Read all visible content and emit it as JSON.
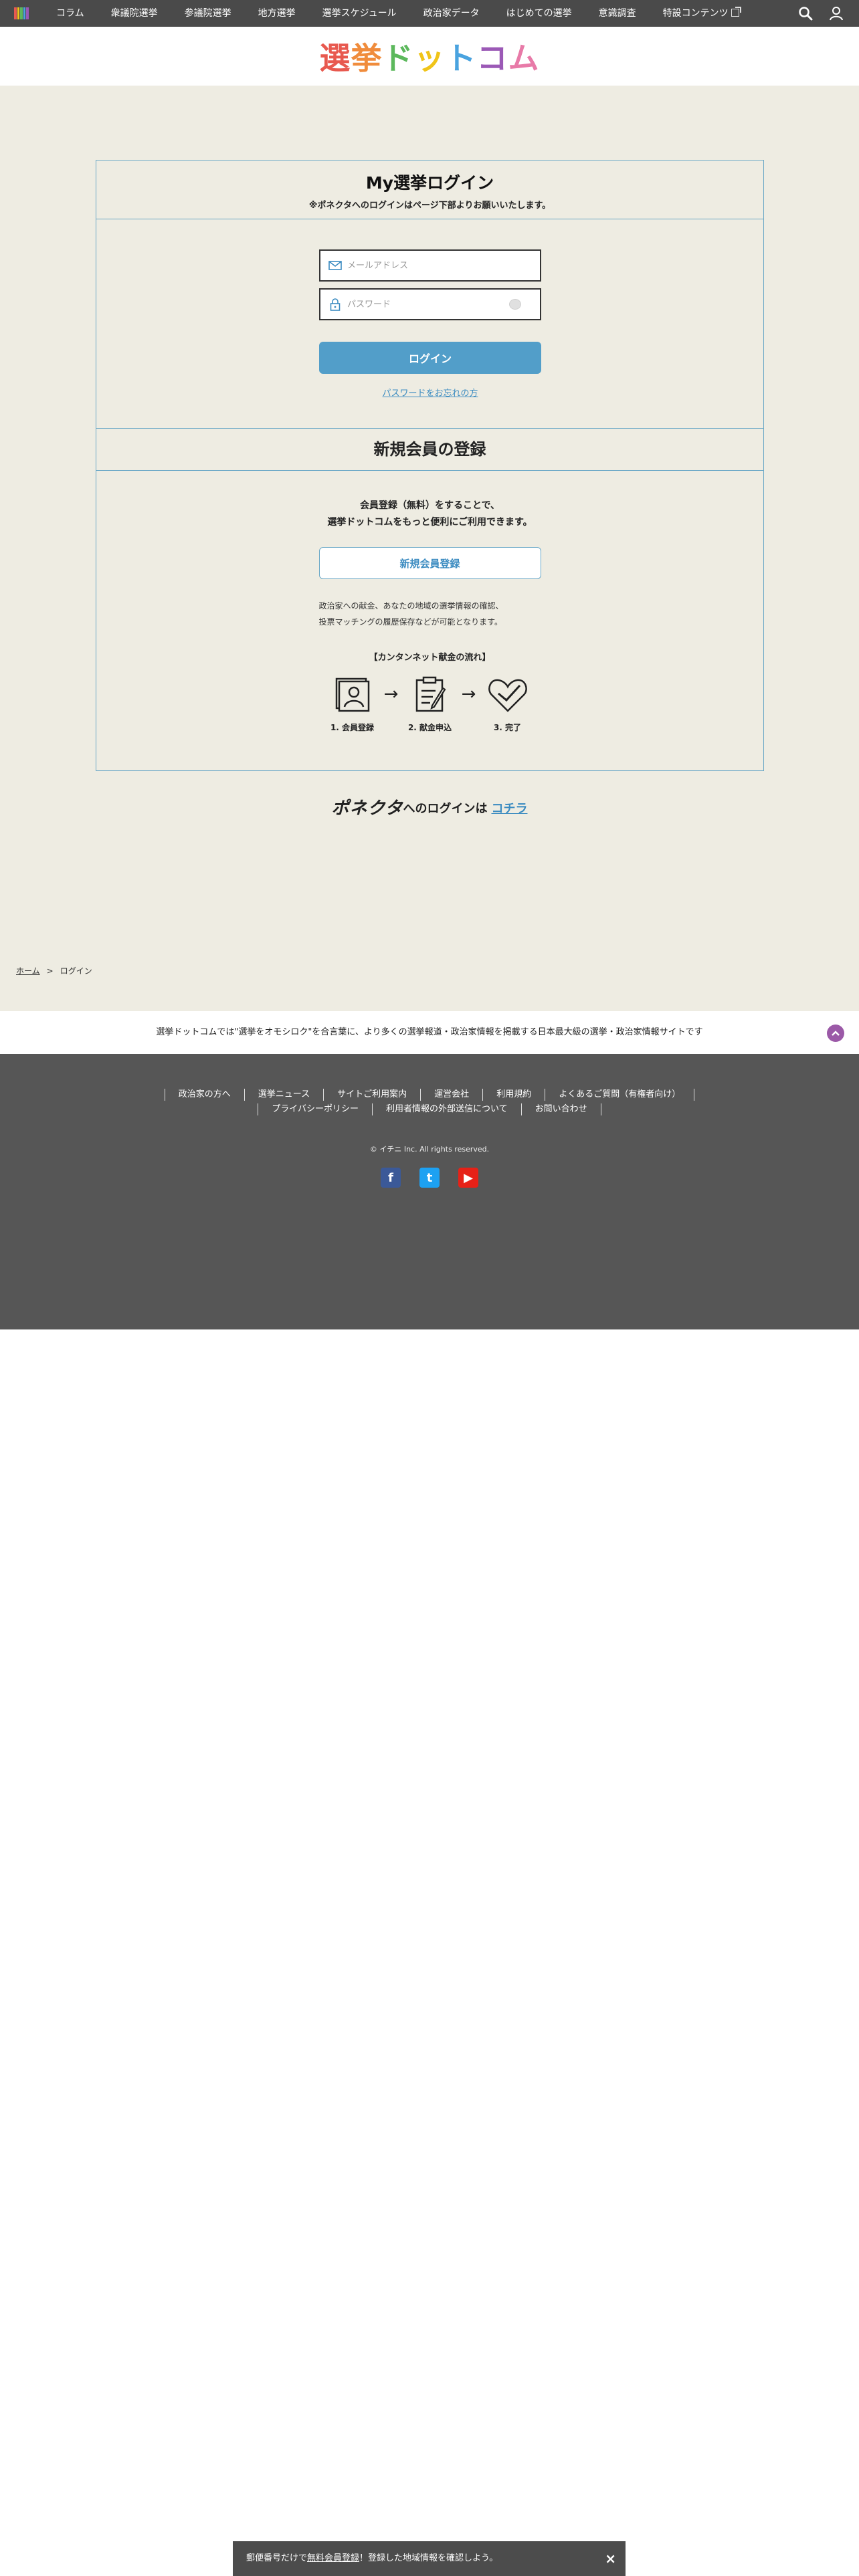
{
  "nav": {
    "home_icon": "books-icon",
    "items": [
      {
        "label": "コラム"
      },
      {
        "label": "衆議院選挙"
      },
      {
        "label": "参議院選挙"
      },
      {
        "label": "地方選挙"
      },
      {
        "label": "選挙スケジュール"
      },
      {
        "label": "政治家データ"
      },
      {
        "label": "はじめての選挙"
      },
      {
        "label": "意識調査"
      },
      {
        "label": "特設コンテンツ"
      }
    ],
    "search_icon": "search-icon",
    "user_icon": "user-icon"
  },
  "logo": {
    "chars": [
      "選",
      "挙",
      "ド",
      "ッ",
      "ト",
      "コ",
      "ム"
    ],
    "colors": [
      "#e8594f",
      "#f08c3c",
      "#5cb85c",
      "#f0c419",
      "#4aa3df",
      "#9b59b6",
      "#e87aa8"
    ]
  },
  "login": {
    "title": "My選挙ログイン",
    "subtitle": "※ポネクタへのログインはページ下部よりお願いいたします。",
    "email_placeholder": "メールアドレス",
    "password_placeholder": "パスワード",
    "login_button": "ログイン",
    "forgot_link": "パスワードをお忘れの方"
  },
  "register": {
    "title": "新規会員の登録",
    "lead_line1": "会員登録（無料）をすることで、",
    "lead_line2": "選挙ドットコムをもっと便利にご利用できます。",
    "button": "新規会員登録",
    "note_line1": "政治家への献金、あなたの地域の選挙情報の確認、",
    "note_line2": "投票マッチングの履歴保存などが可能となります。",
    "flow_title": "【カンタンネット献金の流れ】",
    "steps": [
      {
        "label": "1. 会員登録",
        "icon": "profile-card-icon"
      },
      {
        "label": "2. 献金申込",
        "icon": "clipboard-icon"
      },
      {
        "label": "3. 完了",
        "icon": "heart-check-icon"
      }
    ],
    "arrow": "→"
  },
  "ponekuta": {
    "logo": "ポネクタ",
    "text": "へのログインは",
    "link": "コチラ"
  },
  "breadcrumb": {
    "home": "ホーム",
    "sep": ">",
    "current": "ログイン"
  },
  "tagline": "選挙ドットコムでは\"選挙をオモシロク\"を合言葉に、より多くの選挙報道・政治家情報を掲載する日本最大級の選挙・政治家情報サイトです",
  "footer": {
    "links_row1": [
      "政治家の方へ",
      "選挙ニュース",
      "サイトご利用案内",
      "運営会社",
      "利用規約",
      "よくあるご質問（有権者向け）"
    ],
    "links_row2": [
      "プライバシーポリシー",
      "利用者情報の外部送信について",
      "お問い合わせ"
    ],
    "copyright": "© イチニ Inc. All rights reserved.",
    "social": [
      {
        "name": "facebook-icon",
        "glyph": "f",
        "color": "#3b5998"
      },
      {
        "name": "twitter-icon",
        "glyph": "t",
        "color": "#1da1f2"
      },
      {
        "name": "youtube-icon",
        "glyph": "▶",
        "color": "#e62117"
      }
    ]
  },
  "toast": {
    "before": "郵便番号だけで",
    "link": "無料会員登録",
    "after": "！登録した地域情報を確認しよう。",
    "close": "×"
  }
}
